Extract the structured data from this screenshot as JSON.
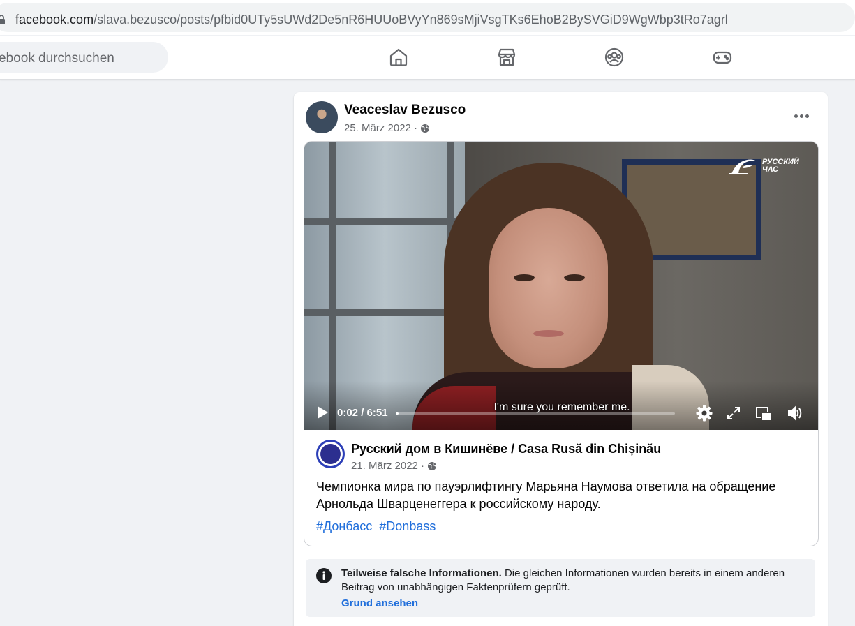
{
  "browser": {
    "url_domain": "facebook.com",
    "url_path": "/slava.bezusco/posts/pfbid0UTy5sUWd2De5nR6HUUoBVyYn869sMjiVsgTKs6EhoB2BySVGiD9WgWbp3tRo7agrl"
  },
  "nav": {
    "search_placeholder": "ebook durchsuchen",
    "icons": [
      "home-icon",
      "marketplace-icon",
      "groups-icon",
      "gaming-icon"
    ]
  },
  "post": {
    "author": "Veaceslav Bezusco",
    "date": "25. März 2022 ·",
    "video": {
      "channel_logo": "РУССКИЙ ЧАС",
      "subtitle": "I'm sure you remember me.",
      "time": "0:02 / 6:51",
      "progress": 0.005
    },
    "shared": {
      "page_name": "Русский дом в Кишинёве / Casa Rusă din Chișinău",
      "date": "21. März 2022 ·",
      "text": "Чемпионка мира по пауэрлифтингу Марьяна Наумова ответила на обращение Арнольда Шварценеггера к российскому народу.",
      "hashtags": [
        "#Донбасс",
        "#Donbass"
      ]
    },
    "factcheck": {
      "title": "Teilweise falsche Informationen.",
      "body": " Die gleichen Informationen wurden bereits in einem anderen Beitrag von unabhängigen Faktenprüfern geprüft.",
      "link": "Grund ansehen"
    }
  }
}
